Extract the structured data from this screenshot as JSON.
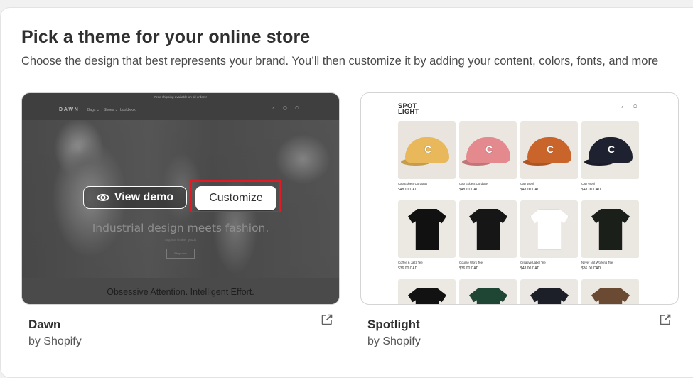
{
  "page": {
    "title": "Pick a theme for your online store",
    "subtitle": "Choose the design that best represents your brand. You’ll then customize it by adding your content, colors, fonts, and more"
  },
  "themes": [
    {
      "name": "Dawn",
      "author": "by Shopify",
      "actions": {
        "view_demo": "View demo",
        "customize": "Customize"
      },
      "preview": {
        "announcement": "Free shipping available on all orders!",
        "logo": "DAWN",
        "nav": [
          "Bags ⌄",
          "Shoes ⌄",
          "Lookbook"
        ],
        "hero_heading": "Industrial design meets fashion.",
        "hero_sub": "Atypical leather goods",
        "hero_button": "Shop now",
        "tagline": "Obsessive Attention. Intelligent Effort."
      }
    },
    {
      "name": "Spotlight",
      "author": "by Shopify",
      "preview": {
        "logo_line1": "SPOT",
        "logo_line2": "LIGHT",
        "products": [
          {
            "name": "Cap Ebbets Corduroy",
            "price": "$48.00 CAD",
            "kind": "cap",
            "color": "#e8b85a",
            "bg": "#e9e4de"
          },
          {
            "name": "Cap Ebbets Corduroy",
            "price": "$48.00 CAD",
            "kind": "cap",
            "color": "#e48a8e",
            "bg": "#ece6e1"
          },
          {
            "name": "Cap Wool",
            "price": "$48.00 CAD",
            "kind": "cap",
            "color": "#c9652a",
            "bg": "#ebe6df"
          },
          {
            "name": "Cap Wool",
            "price": "$48.00 CAD",
            "kind": "cap",
            "color": "#1e2230",
            "bg": "#ebe7e1"
          },
          {
            "name": "Coffee & Jazz Tee",
            "price": "$36.00 CAD",
            "kind": "tee",
            "color": "#111111",
            "bg": "#ece8e2"
          },
          {
            "name": "Course Work Tee",
            "price": "$36.00 CAD",
            "kind": "tee",
            "color": "#161616",
            "bg": "#ebe7e2"
          },
          {
            "name": "Creative Label Tee",
            "price": "$48.00 CAD",
            "kind": "tee",
            "color": "#ffffff",
            "bg": "#ebe8e3"
          },
          {
            "name": "Never Not Working Tee",
            "price": "$36.00 CAD",
            "kind": "tee",
            "color": "#1a1f1a",
            "bg": "#ebe7e1"
          },
          {
            "name": "",
            "price": "",
            "kind": "tee",
            "color": "#121212",
            "bg": "#ece8e2"
          },
          {
            "name": "",
            "price": "",
            "kind": "tee",
            "color": "#1f4634",
            "bg": "#ebe7e2"
          },
          {
            "name": "",
            "price": "",
            "kind": "tee",
            "color": "#1c1e28",
            "bg": "#ebe8e3"
          },
          {
            "name": "",
            "price": "",
            "kind": "tee",
            "color": "#6a4a32",
            "bg": "#ebe7e1"
          }
        ]
      }
    }
  ],
  "colors": {
    "highlight": "#e01b24",
    "surface": "#ffffff",
    "text": "#303030"
  }
}
